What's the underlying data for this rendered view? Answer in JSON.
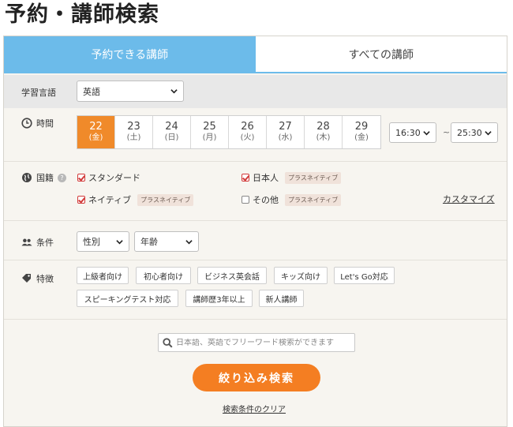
{
  "page_title": "予約・講師検索",
  "tabs": [
    {
      "label": "予約できる講師",
      "active": true
    },
    {
      "label": "すべての講師",
      "active": false
    }
  ],
  "language": {
    "label": "学習言語",
    "selected": "英語"
  },
  "time": {
    "label": "時間",
    "dates": [
      {
        "day": "22",
        "weekday": "(金)",
        "selected": true
      },
      {
        "day": "23",
        "weekday": "(土)",
        "selected": false
      },
      {
        "day": "24",
        "weekday": "(日)",
        "selected": false
      },
      {
        "day": "25",
        "weekday": "(月)",
        "selected": false
      },
      {
        "day": "26",
        "weekday": "(火)",
        "selected": false
      },
      {
        "day": "27",
        "weekday": "(水)",
        "selected": false
      },
      {
        "day": "28",
        "weekday": "(木)",
        "selected": false
      },
      {
        "day": "29",
        "weekday": "(金)",
        "selected": false
      }
    ],
    "start": "16:30",
    "separator": "~",
    "end": "25:30"
  },
  "nationality": {
    "label": "国籍",
    "help_icon": "?",
    "options": [
      {
        "label": "スタンダード",
        "checked": true,
        "badge": ""
      },
      {
        "label": "日本人",
        "checked": true,
        "badge": "プラスネイティブ"
      },
      {
        "label": "ネイティブ",
        "checked": true,
        "badge": "プラスネイティブ"
      },
      {
        "label": "その他",
        "checked": false,
        "badge": "プラスネイティブ"
      }
    ],
    "customize_link": "カスタマイズ"
  },
  "conditions": {
    "label": "条件",
    "gender": "性別",
    "age": "年齢"
  },
  "features": {
    "label": "特徴",
    "tags": [
      "上級者向け",
      "初心者向け",
      "ビジネス英会話",
      "キッズ向け",
      "Let's Go対応",
      "スピーキングテスト対応",
      "講師歴3年以上",
      "新人講師"
    ]
  },
  "search": {
    "placeholder": "日本語、英語でフリーワード検索ができます"
  },
  "submit_label": "絞り込み検索",
  "clear_link": "検索条件のクリア",
  "colors": {
    "accent_blue": "#6cbbea",
    "accent_orange": "#f47e22",
    "selected_date": "#f08a2a"
  }
}
